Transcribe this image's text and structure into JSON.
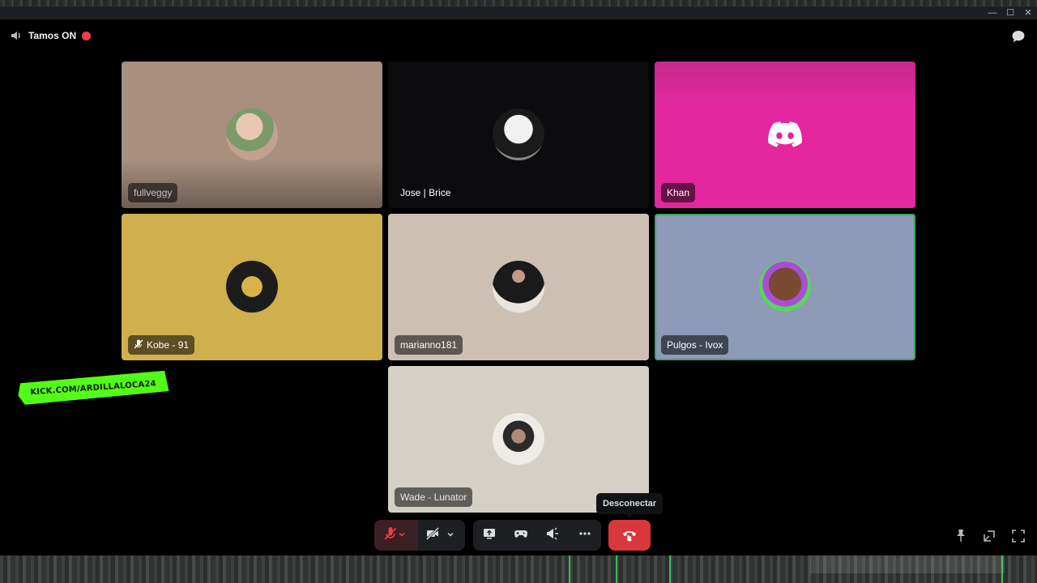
{
  "window": {
    "controls": [
      "—",
      "☐",
      "✕"
    ]
  },
  "channel": {
    "name": "Tamos ON",
    "icon": "speaker-icon",
    "live_color": "#f23f43"
  },
  "participants": [
    {
      "name": "fullveggy",
      "bg": "#a88f7e",
      "muted": false,
      "speaking": false
    },
    {
      "name": "Jose | Brice",
      "bg": "#0c0c0e",
      "muted": false,
      "speaking": false
    },
    {
      "name": "Khan",
      "bg": "#e3279f",
      "muted": false,
      "speaking": false
    },
    {
      "name": "Kobe - 91",
      "bg": "#cfb04c",
      "muted": true,
      "speaking": false
    },
    {
      "name": "marianno181",
      "bg": "#cdc0b3",
      "muted": false,
      "speaking": false
    },
    {
      "name": "Pulgos - Ivox",
      "bg": "#8d9ab8",
      "muted": false,
      "speaking": true
    },
    {
      "name": "Wade - Lunator",
      "bg": "#d4d0c8",
      "muted": false,
      "speaking": false
    }
  ],
  "sticker": {
    "text": "KICK.COM/ARDILLALOCA24",
    "color": "#53fc18"
  },
  "tooltip": {
    "text": "Desconectar"
  },
  "controls": {
    "mic": "mic-muted-icon",
    "camera": "camera-off-icon",
    "share_screen": "share-screen-icon",
    "activity": "gamepad-icon",
    "soundboard": "soundboard-icon",
    "more": "more-icon",
    "disconnect": "hangup-icon",
    "disconnect_color": "#da373c"
  },
  "corner_controls": [
    "pin-icon",
    "popout-icon",
    "fullscreen-icon"
  ]
}
